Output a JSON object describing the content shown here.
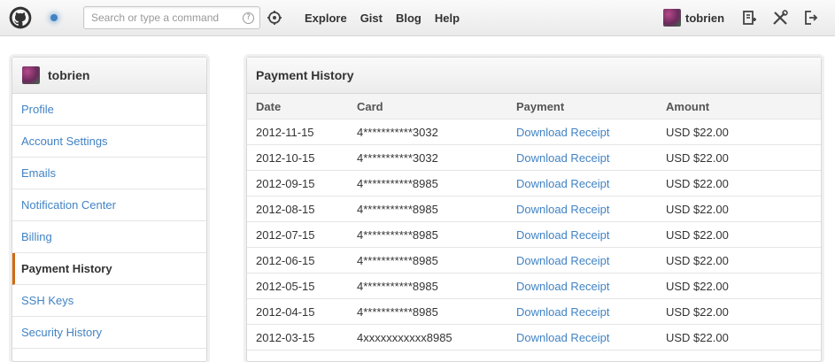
{
  "header": {
    "search_placeholder": "Search or type a command",
    "search_help": "?",
    "nav": [
      {
        "label": "Explore"
      },
      {
        "label": "Gist"
      },
      {
        "label": "Blog"
      },
      {
        "label": "Help"
      }
    ],
    "username": "tobrien",
    "colors": {
      "accent": "#4183c4"
    }
  },
  "sidebar": {
    "username": "tobrien",
    "items": [
      {
        "label": "Profile"
      },
      {
        "label": "Account Settings"
      },
      {
        "label": "Emails"
      },
      {
        "label": "Notification Center"
      },
      {
        "label": "Billing"
      },
      {
        "label": "Payment History"
      },
      {
        "label": "SSH Keys"
      },
      {
        "label": "Security History"
      }
    ],
    "active_index": 5,
    "active_color": "#d26911"
  },
  "main": {
    "title": "Payment History",
    "columns": [
      "Date",
      "Card",
      "Payment",
      "Amount"
    ],
    "rows": [
      {
        "date": "2012-11-15",
        "card": "4***********3032",
        "payment": "Download Receipt",
        "amount": "USD $22.00"
      },
      {
        "date": "2012-10-15",
        "card": "4***********3032",
        "payment": "Download Receipt",
        "amount": "USD $22.00"
      },
      {
        "date": "2012-09-15",
        "card": "4***********8985",
        "payment": "Download Receipt",
        "amount": "USD $22.00"
      },
      {
        "date": "2012-08-15",
        "card": "4***********8985",
        "payment": "Download Receipt",
        "amount": "USD $22.00"
      },
      {
        "date": "2012-07-15",
        "card": "4***********8985",
        "payment": "Download Receipt",
        "amount": "USD $22.00"
      },
      {
        "date": "2012-06-15",
        "card": "4***********8985",
        "payment": "Download Receipt",
        "amount": "USD $22.00"
      },
      {
        "date": "2012-05-15",
        "card": "4***********8985",
        "payment": "Download Receipt",
        "amount": "USD $22.00"
      },
      {
        "date": "2012-04-15",
        "card": "4***********8985",
        "payment": "Download Receipt",
        "amount": "USD $22.00"
      },
      {
        "date": "2012-03-15",
        "card": "4xxxxxxxxxxx8985",
        "payment": "Download Receipt",
        "amount": "USD $22.00"
      }
    ]
  },
  "icons": [
    "github-octocat-icon",
    "notification-dot-icon",
    "help-icon",
    "command-palette-icon",
    "avatar",
    "new-repo-icon",
    "settings-tools-icon",
    "sign-out-icon"
  ]
}
